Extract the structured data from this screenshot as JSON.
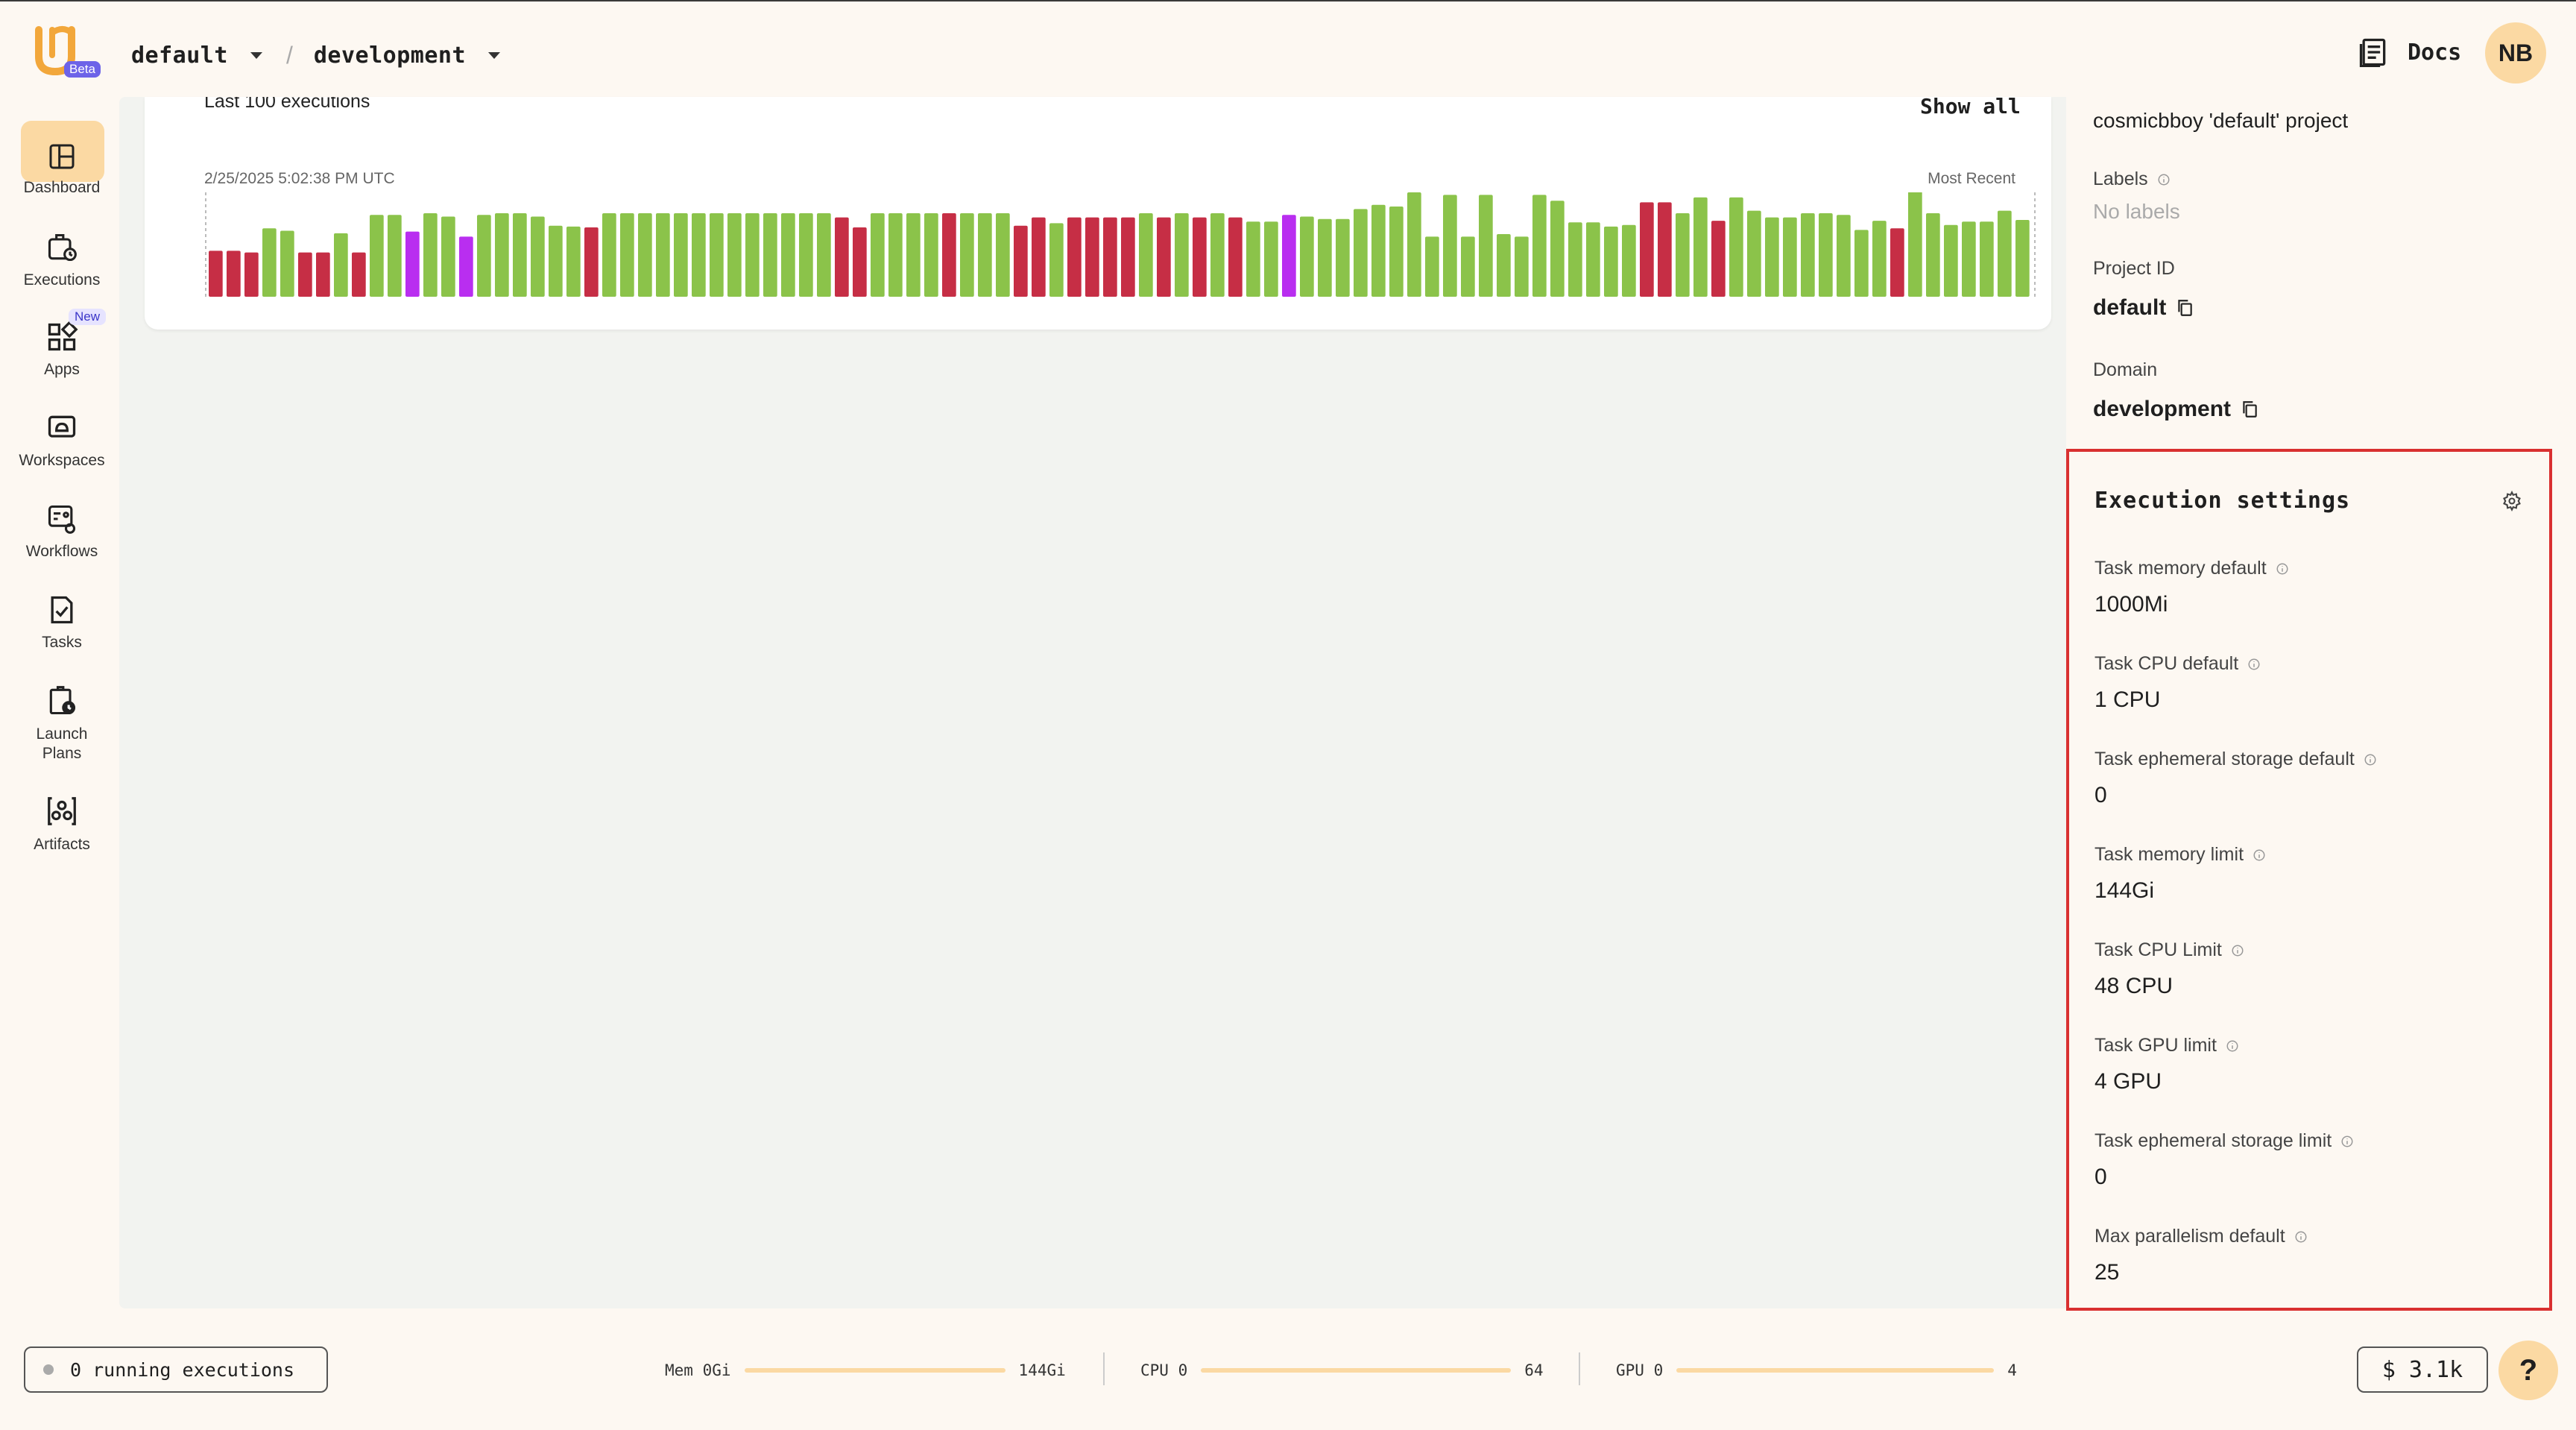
{
  "header": {
    "logo_badge": "Beta",
    "project": "default",
    "domain": "development",
    "docs_label": "Docs",
    "avatar_initials": "NB"
  },
  "sidebar": {
    "items": [
      {
        "label": "Dashboard",
        "icon": "dashboard-icon",
        "active": true
      },
      {
        "label": "Executions",
        "icon": "executions-icon"
      },
      {
        "label": "Apps",
        "icon": "apps-icon",
        "badge": "New"
      },
      {
        "label": "Workspaces",
        "icon": "workspaces-icon"
      },
      {
        "label": "Workflows",
        "icon": "workflows-icon"
      },
      {
        "label": "Tasks",
        "icon": "tasks-icon"
      },
      {
        "label": "Launch\nPlans",
        "icon": "launch-plans-icon"
      },
      {
        "label": "Artifacts",
        "icon": "artifacts-icon"
      }
    ]
  },
  "executions_card": {
    "title": "Last 100 executions",
    "show_all_label": "Show all",
    "start_timestamp": "2/25/2025 5:02:38 PM UTC",
    "end_label": "Most Recent",
    "colors": {
      "succeeded": "#8bc34a",
      "failed": "#c62e45",
      "aborted": "#b92ef0"
    },
    "bars": [
      {
        "s": "failed",
        "v": 0.55
      },
      {
        "s": "failed",
        "v": 0.55
      },
      {
        "s": "failed",
        "v": 0.53
      },
      {
        "s": "succeeded",
        "v": 0.82
      },
      {
        "s": "succeeded",
        "v": 0.79
      },
      {
        "s": "failed",
        "v": 0.53
      },
      {
        "s": "failed",
        "v": 0.53
      },
      {
        "s": "succeeded",
        "v": 0.76
      },
      {
        "s": "failed",
        "v": 0.53
      },
      {
        "s": "succeeded",
        "v": 0.98
      },
      {
        "s": "succeeded",
        "v": 0.98
      },
      {
        "s": "aborted",
        "v": 0.78
      },
      {
        "s": "succeeded",
        "v": 1.0
      },
      {
        "s": "succeeded",
        "v": 0.96
      },
      {
        "s": "aborted",
        "v": 0.72
      },
      {
        "s": "succeeded",
        "v": 0.98
      },
      {
        "s": "succeeded",
        "v": 1.0
      },
      {
        "s": "succeeded",
        "v": 1.0
      },
      {
        "s": "succeeded",
        "v": 0.96
      },
      {
        "s": "succeeded",
        "v": 0.85
      },
      {
        "s": "succeeded",
        "v": 0.84
      },
      {
        "s": "failed",
        "v": 0.83
      },
      {
        "s": "succeeded",
        "v": 1.0
      },
      {
        "s": "succeeded",
        "v": 1.0
      },
      {
        "s": "succeeded",
        "v": 1.0
      },
      {
        "s": "succeeded",
        "v": 1.0
      },
      {
        "s": "succeeded",
        "v": 1.0
      },
      {
        "s": "succeeded",
        "v": 1.0
      },
      {
        "s": "succeeded",
        "v": 1.0
      },
      {
        "s": "succeeded",
        "v": 1.0
      },
      {
        "s": "succeeded",
        "v": 1.0
      },
      {
        "s": "succeeded",
        "v": 1.0
      },
      {
        "s": "succeeded",
        "v": 1.0
      },
      {
        "s": "succeeded",
        "v": 1.0
      },
      {
        "s": "succeeded",
        "v": 1.0
      },
      {
        "s": "failed",
        "v": 0.95
      },
      {
        "s": "failed",
        "v": 0.83
      },
      {
        "s": "succeeded",
        "v": 1.0
      },
      {
        "s": "succeeded",
        "v": 1.0
      },
      {
        "s": "succeeded",
        "v": 1.0
      },
      {
        "s": "succeeded",
        "v": 1.0
      },
      {
        "s": "failed",
        "v": 1.0
      },
      {
        "s": "succeeded",
        "v": 1.0
      },
      {
        "s": "succeeded",
        "v": 1.0
      },
      {
        "s": "succeeded",
        "v": 1.0
      },
      {
        "s": "failed",
        "v": 0.85
      },
      {
        "s": "failed",
        "v": 0.95
      },
      {
        "s": "succeeded",
        "v": 0.88
      },
      {
        "s": "failed",
        "v": 0.95
      },
      {
        "s": "failed",
        "v": 0.95
      },
      {
        "s": "failed",
        "v": 0.95
      },
      {
        "s": "failed",
        "v": 0.95
      },
      {
        "s": "succeeded",
        "v": 1.0
      },
      {
        "s": "failed",
        "v": 0.95
      },
      {
        "s": "succeeded",
        "v": 1.0
      },
      {
        "s": "failed",
        "v": 0.95
      },
      {
        "s": "succeeded",
        "v": 1.0
      },
      {
        "s": "failed",
        "v": 0.95
      },
      {
        "s": "succeeded",
        "v": 0.9
      },
      {
        "s": "succeeded",
        "v": 0.9
      },
      {
        "s": "aborted",
        "v": 0.98
      },
      {
        "s": "succeeded",
        "v": 0.96
      },
      {
        "s": "succeeded",
        "v": 0.93
      },
      {
        "s": "succeeded",
        "v": 0.93
      },
      {
        "s": "succeeded",
        "v": 1.05
      },
      {
        "s": "succeeded",
        "v": 1.1
      },
      {
        "s": "succeeded",
        "v": 1.08
      },
      {
        "s": "succeeded",
        "v": 1.25
      },
      {
        "s": "succeeded",
        "v": 0.72
      },
      {
        "s": "succeeded",
        "v": 1.22
      },
      {
        "s": "succeeded",
        "v": 0.72
      },
      {
        "s": "succeeded",
        "v": 1.22
      },
      {
        "s": "succeeded",
        "v": 0.75
      },
      {
        "s": "succeeded",
        "v": 0.72
      },
      {
        "s": "succeeded",
        "v": 1.22
      },
      {
        "s": "succeeded",
        "v": 1.15
      },
      {
        "s": "succeeded",
        "v": 0.89
      },
      {
        "s": "succeeded",
        "v": 0.89
      },
      {
        "s": "succeeded",
        "v": 0.84
      },
      {
        "s": "succeeded",
        "v": 0.86
      },
      {
        "s": "failed",
        "v": 1.13
      },
      {
        "s": "failed",
        "v": 1.13
      },
      {
        "s": "succeeded",
        "v": 1.0
      },
      {
        "s": "succeeded",
        "v": 1.19
      },
      {
        "s": "failed",
        "v": 0.91
      },
      {
        "s": "succeeded",
        "v": 1.19
      },
      {
        "s": "succeeded",
        "v": 1.03
      },
      {
        "s": "succeeded",
        "v": 0.95
      },
      {
        "s": "succeeded",
        "v": 0.95
      },
      {
        "s": "succeeded",
        "v": 1.0
      },
      {
        "s": "succeeded",
        "v": 1.0
      },
      {
        "s": "succeeded",
        "v": 0.98
      },
      {
        "s": "succeeded",
        "v": 0.8
      },
      {
        "s": "succeeded",
        "v": 0.91
      },
      {
        "s": "failed",
        "v": 0.82
      },
      {
        "s": "succeeded",
        "v": 1.26
      },
      {
        "s": "succeeded",
        "v": 1.0
      },
      {
        "s": "succeeded",
        "v": 0.86
      },
      {
        "s": "succeeded",
        "v": 0.9
      },
      {
        "s": "succeeded",
        "v": 0.9
      },
      {
        "s": "succeeded",
        "v": 1.03
      },
      {
        "s": "succeeded",
        "v": 0.92
      }
    ]
  },
  "project_info": {
    "description": "cosmicbboy 'default' project",
    "labels_label": "Labels",
    "labels_value": "No labels",
    "project_id_label": "Project ID",
    "project_id_value": "default",
    "domain_label": "Domain",
    "domain_value": "development"
  },
  "execution_settings": {
    "title": "Execution settings",
    "items": [
      {
        "label": "Task memory default",
        "value": "1000Mi"
      },
      {
        "label": "Task CPU default",
        "value": "1 CPU"
      },
      {
        "label": "Task ephemeral storage default",
        "value": "0"
      },
      {
        "label": "Task memory limit",
        "value": "144Gi"
      },
      {
        "label": "Task CPU Limit",
        "value": "48 CPU"
      },
      {
        "label": "Task GPU limit",
        "value": "4 GPU"
      },
      {
        "label": "Task ephemeral storage limit",
        "value": "0"
      },
      {
        "label": "Max parallelism default",
        "value": "25"
      }
    ]
  },
  "footer": {
    "running_label": "0 running executions",
    "mem": {
      "label": "Mem",
      "used": "0Gi",
      "max": "144Gi"
    },
    "cpu": {
      "label": "CPU",
      "used": "0",
      "max": "64"
    },
    "gpu": {
      "label": "GPU",
      "used": "0",
      "max": "4"
    },
    "cost_currency": "$",
    "cost_value": "3.1k",
    "help_label": "?"
  }
}
